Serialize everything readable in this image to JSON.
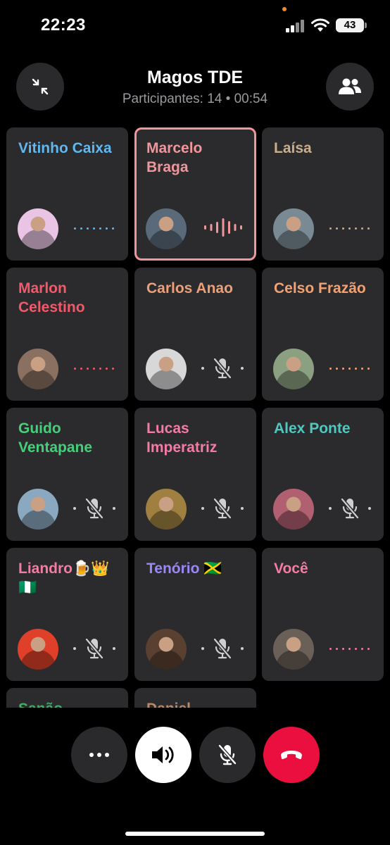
{
  "status_bar": {
    "time": "22:23",
    "battery": "43"
  },
  "header": {
    "title": "Magos TDE",
    "subtitle": "Participantes: 14 • 00:54"
  },
  "participants": [
    {
      "name": "Vitinho Caixa",
      "color": "#5fb8f0",
      "state": "waiting",
      "avatar_bg": "#e9c4e4"
    },
    {
      "name": "Marcelo Braga",
      "color": "#f1969b",
      "state": "speaking",
      "avatar_bg": "#5a6a7a"
    },
    {
      "name": "Laísa",
      "color": "#c9ad8c",
      "state": "waiting",
      "avatar_bg": "#7a8a95"
    },
    {
      "name": "Marlon Celestino",
      "color": "#f05a6b",
      "state": "waiting",
      "avatar_bg": "#8a7060"
    },
    {
      "name": "Carlos Anao",
      "color": "#eba079",
      "state": "muted",
      "avatar_bg": "#d8d8d8"
    },
    {
      "name": "Celso Frazão",
      "color": "#f2a272",
      "state": "waiting",
      "avatar_bg": "#8aa080"
    },
    {
      "name": "Guido Ventapane",
      "color": "#44d07b",
      "state": "muted",
      "avatar_bg": "#8aa8c0"
    },
    {
      "name": "Lucas Imperatriz",
      "color": "#f47ba2",
      "state": "muted",
      "avatar_bg": "#a08040"
    },
    {
      "name": "Alex Ponte",
      "color": "#4fc8bf",
      "state": "muted",
      "avatar_bg": "#b06070"
    },
    {
      "name": "Liandro🍺👑🇳🇬",
      "color": "#f47ba2",
      "state": "muted",
      "avatar_bg": "#e0402a"
    },
    {
      "name": "Tenório 🇯🇲",
      "color": "#9b87f5",
      "state": "muted",
      "avatar_bg": "#5a4030"
    },
    {
      "name": "Você",
      "color": "#f47ba2",
      "state": "waiting",
      "avatar_bg": "#6a6058"
    },
    {
      "name": "Sanão",
      "color": "#3fae6a",
      "state": "muted",
      "avatar_bg": "#555555"
    },
    {
      "name": "Daniel",
      "color": "#b98a6a",
      "state": "muted",
      "avatar_bg": "#555555"
    }
  ],
  "controls": [
    "more",
    "speaker",
    "microphone-off",
    "end-call"
  ],
  "icons": {
    "minimize": "minimize-icon",
    "participants": "people-icon",
    "more": "more-dots-icon",
    "speaker": "speaker-icon",
    "mic_off": "mic-off-icon",
    "end_call": "phone-hangup-icon"
  }
}
